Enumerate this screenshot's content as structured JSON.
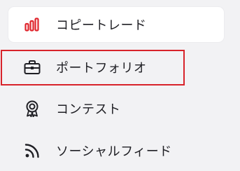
{
  "nav": {
    "items": [
      {
        "label": "コピートレード",
        "icon": "bar-chart-icon",
        "active": true
      },
      {
        "label": "ポートフォリオ",
        "icon": "briefcase-icon",
        "active": false
      },
      {
        "label": "コンテスト",
        "icon": "award-medal-icon",
        "active": false
      },
      {
        "label": "ソーシャルフィード",
        "icon": "rss-feed-icon",
        "active": false
      }
    ],
    "highlighted_item": "ポートフォリオ"
  },
  "colors": {
    "accent": "#e0262d",
    "highlight_border": "#d8232a",
    "background": "#f2f2f4",
    "active_background": "#ffffff",
    "text": "#1f1f24"
  }
}
